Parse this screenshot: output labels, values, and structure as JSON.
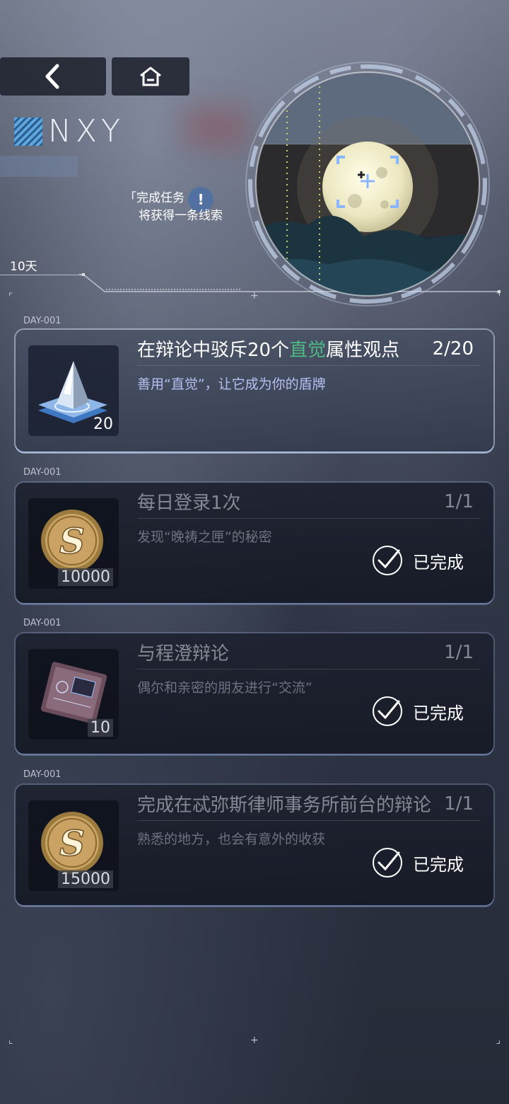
{
  "header": {
    "logo_text": "NXY",
    "back_icon": "chevron-left-icon",
    "home_icon": "home-icon"
  },
  "hint": {
    "line1": "「完成任务",
    "line2": "将获得一条线索",
    "badge": "!"
  },
  "progress": {
    "days_label": "10天"
  },
  "tasks": [
    {
      "day": "DAY-001",
      "title_pre": "在辩论中驳斥20个",
      "title_hl": "直觉",
      "title_post": "属性观点",
      "count": "2/20",
      "desc": "善用“直觉”，让它成为你的盾牌",
      "qty": "20",
      "item": "prism-icon",
      "status": ""
    },
    {
      "day": "DAY-001",
      "title": "每日登录1次",
      "count": "1/1",
      "desc": "发现“晚祷之匣”的秘密",
      "qty": "10000",
      "item": "coin-icon",
      "status": "已完成"
    },
    {
      "day": "DAY-001",
      "title": "与程澄辩论",
      "count": "1/1",
      "desc": "偶尔和亲密的朋友进行“交流”",
      "qty": "10",
      "item": "chip-card-icon",
      "status": "已完成"
    },
    {
      "day": "DAY-001",
      "title": "完成在忒弥斯律师事务所前台的辩论",
      "count": "1/1",
      "desc": "熟悉的地方，也会有意外的收获",
      "qty": "15000",
      "item": "coin-icon",
      "status": "已完成"
    }
  ],
  "colors": {
    "highlight": "#4fb985",
    "desc": "#b5c0f0"
  }
}
